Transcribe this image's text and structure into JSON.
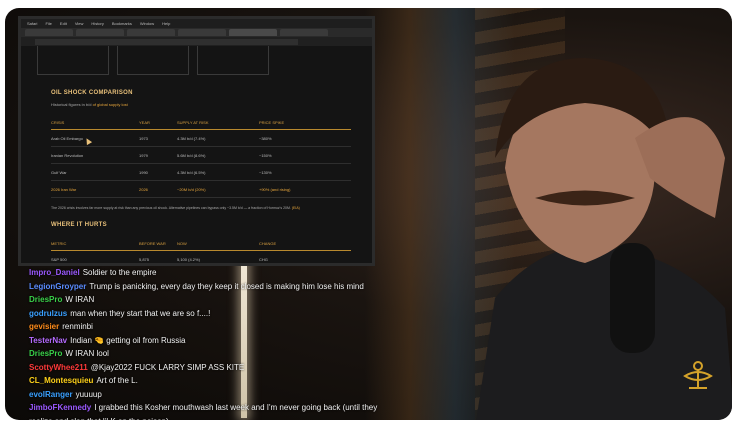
{
  "browser": {
    "menu": [
      "Safari",
      "File",
      "Edit",
      "View",
      "History",
      "Bookmarks",
      "Window",
      "Help"
    ],
    "tabs": [
      "",
      "",
      "",
      "",
      "",
      "",
      ""
    ],
    "url": ""
  },
  "article": {
    "cards": [
      "",
      "",
      ""
    ],
    "section1_title": "OIL SHOCK COMPARISON",
    "section1_subtitle_prefix": "Historical figures in b/d",
    "section1_subtitle_highlight": "of global supply lost",
    "table1": {
      "headers": [
        "CRISIS",
        "YEAR",
        "SUPPLY AT RISK",
        "PRICE SPIKE"
      ],
      "rows": [
        [
          "Arab Oil Embargo",
          "1973",
          "4.3M b/d (7.4%)",
          "~380%"
        ],
        [
          "Iranian Revolution",
          "1979",
          "5.6M b/d (8.6%)",
          "~150%"
        ],
        [
          "Gulf War",
          "1990",
          "4.3M b/d (6.5%)",
          "~130%"
        ],
        [
          "2026 Iran War",
          "2026",
          "~20M b/d (20%)",
          "+90% (and rising)"
        ]
      ]
    },
    "note": "The 2026 crisis involves far more supply at risk than any previous oil shock. Alternative pipelines can bypass only ~3.5M b/d — a fraction of Hormuz's 20M.",
    "note_highlight": "(EIA)",
    "section2_title": "WHERE IT HURTS",
    "table2": {
      "headers": [
        "METRIC",
        "BEFORE WAR",
        "NOW",
        "CHANGE"
      ],
      "rows": [
        [
          "S&P 500",
          "5,875",
          "5,100 (4.2%)",
          "CHG"
        ]
      ]
    }
  },
  "chat": [
    {
      "user": "Impro_Daniel",
      "color": "#9b59ff",
      "text": "Soldier to the empire"
    },
    {
      "user": "LegionGroyper",
      "color": "#5b8cff",
      "text": "Trump is panicking, every day they keep it closed is making him lose his mind"
    },
    {
      "user": "DriesPro",
      "color": "#3ad14a",
      "text": "W IRAN"
    },
    {
      "user": "godrulzus",
      "color": "#3aa0ff",
      "text": "man when they start that we are so f....!"
    },
    {
      "user": "gevisier",
      "color": "#ff8c1a",
      "text": "renminbi"
    },
    {
      "user": "TesterNav",
      "color": "#b56bff",
      "text": "Indian 🤏 getting oil from Russia"
    },
    {
      "user": "DriesPro",
      "color": "#3ad14a",
      "text": "W IRAN lool"
    },
    {
      "user": "ScottyWhee211",
      "color": "#ff3a3a",
      "text": "@Kjay2022 FUCK LARRY SIMP ASS KITE"
    },
    {
      "user": "CL_Montesquieu",
      "color": "#ffd21a",
      "text": "Art of the L."
    },
    {
      "user": "evolRanger",
      "color": "#3aa0ff",
      "text": "yuuuup"
    },
    {
      "user": "JimboFKennedy",
      "color": "#9b59ff",
      "text": "I grabbed this Kosher mouthwash last week and I'm never going back (until they"
    },
    {
      "user": "",
      "color": "#ffffff",
      "text": "realize and slap that lil K on the poison)"
    }
  ],
  "colors": {
    "accent": "#e8a73c",
    "logo": "#d4a22a"
  }
}
